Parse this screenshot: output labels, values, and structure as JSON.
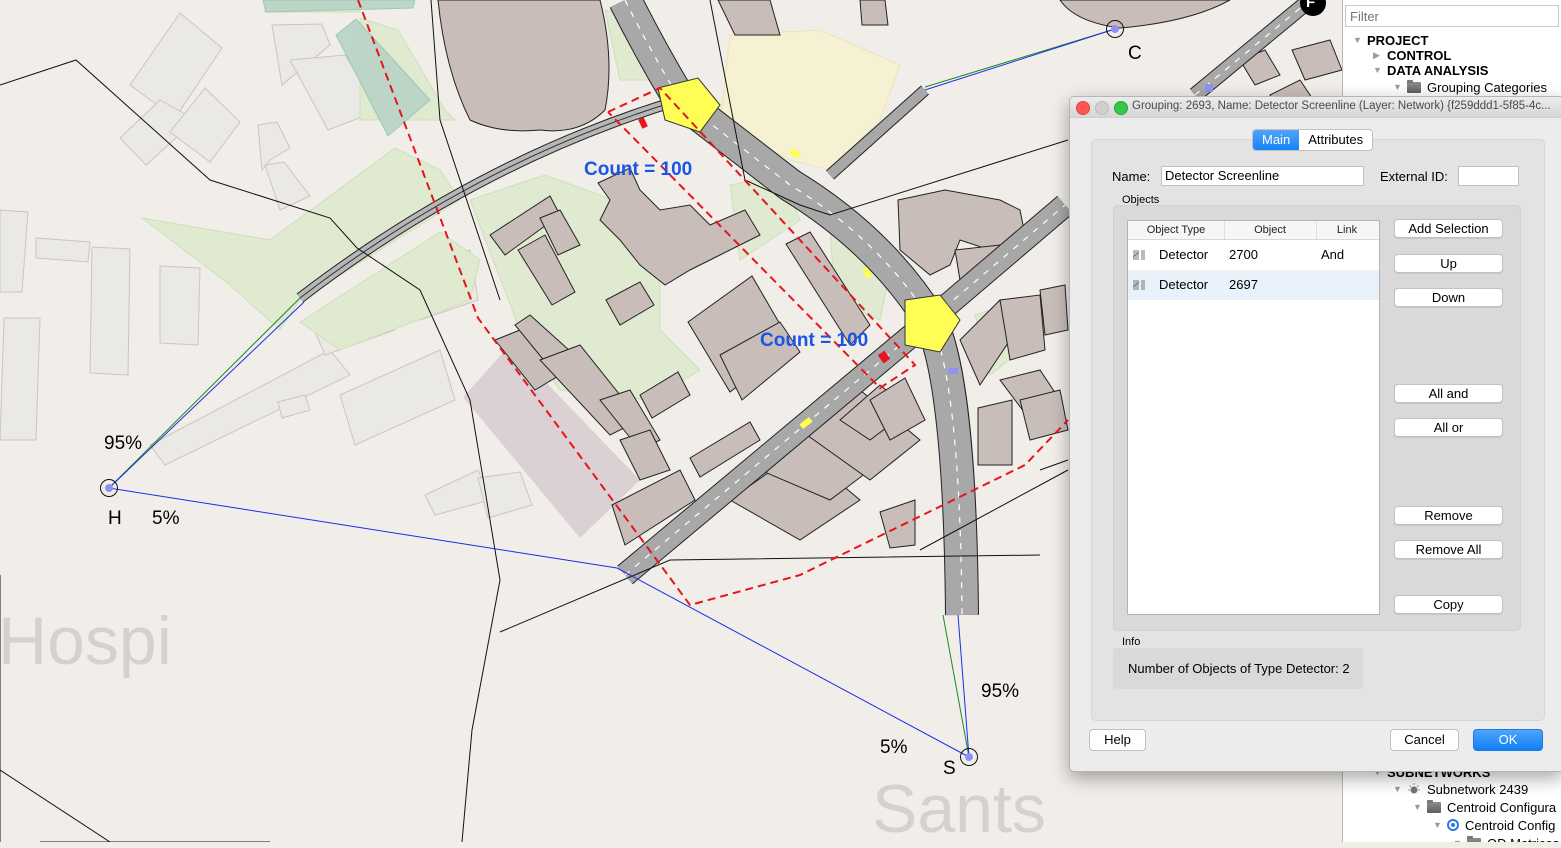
{
  "map": {
    "count_labels": [
      "Count = 100",
      "Count = 100"
    ],
    "centroids": [
      {
        "label": "H",
        "pct_top": "95%",
        "pct_bottom": "5%"
      },
      {
        "label": "S",
        "pct_top": "95%",
        "pct_bottom": "5%"
      },
      {
        "label": "C"
      }
    ],
    "node_marker": "F",
    "district_labels": [
      "Hospi",
      "Sants"
    ],
    "colors": {
      "background": "#f1eee9",
      "building": "#c9bdb9",
      "park": "#dfeacf",
      "road": "#a9a9a9",
      "junction": "#fefe55",
      "screenline": "#e8141b",
      "path_blue": "#1c2ce6",
      "path_green": "#1d8a1d",
      "count_text": "#1a55e6"
    }
  },
  "tree": {
    "filter_placeholder": "Filter",
    "items": [
      {
        "label": "PROJECT",
        "bold": true,
        "expanded": true
      },
      {
        "label": "CONTROL",
        "bold": true,
        "expanded": false
      },
      {
        "label": "DATA ANALYSIS",
        "bold": true,
        "expanded": true
      },
      {
        "label": "Grouping Categories",
        "icon": "folder-icon",
        "expanded": true
      },
      {
        "label": "SUBNETWORKS",
        "bold": true,
        "expanded": true
      },
      {
        "label": "Subnetwork 2439",
        "icon": "subnetwork-icon",
        "expanded": true
      },
      {
        "label": "Centroid Configura",
        "icon": "folder-icon",
        "expanded": true
      },
      {
        "label": "Centroid Config",
        "icon": "centroid-config-icon",
        "expanded": true
      },
      {
        "label": "OD Matrices",
        "icon": "folder-icon",
        "expanded": true
      }
    ]
  },
  "dialog": {
    "title": "Grouping: 2693, Name: Detector Screenline (Layer: Network) {f259ddd1-5f85-4c...",
    "tabs": [
      {
        "label": "Main",
        "active": true
      },
      {
        "label": "Attributes",
        "active": false
      }
    ],
    "name_label": "Name:",
    "name_value": "Detector Screenline",
    "external_id_label": "External ID:",
    "external_id_value": "",
    "objects_group_label": "Objects",
    "table": {
      "columns": [
        "Object Type",
        "Object",
        "Link"
      ],
      "rows": [
        {
          "type": "Detector",
          "object": "2700",
          "link": "And",
          "selected": false
        },
        {
          "type": "Detector",
          "object": "2697",
          "link": "",
          "selected": true
        }
      ]
    },
    "side_buttons": {
      "add_selection": "Add Selection",
      "up": "Up",
      "down": "Down",
      "all_and": "All and",
      "all_or": "All or",
      "remove": "Remove",
      "remove_all": "Remove All",
      "copy": "Copy"
    },
    "info_group_label": "Info",
    "info_text": "Number of Objects of Type Detector: 2",
    "footer": {
      "help": "Help",
      "cancel": "Cancel",
      "ok": "OK"
    },
    "colors": {
      "accent": "#1583f7",
      "close": "#fc5753",
      "minimize": "#d0d0d0",
      "zoom": "#34c84a"
    }
  }
}
